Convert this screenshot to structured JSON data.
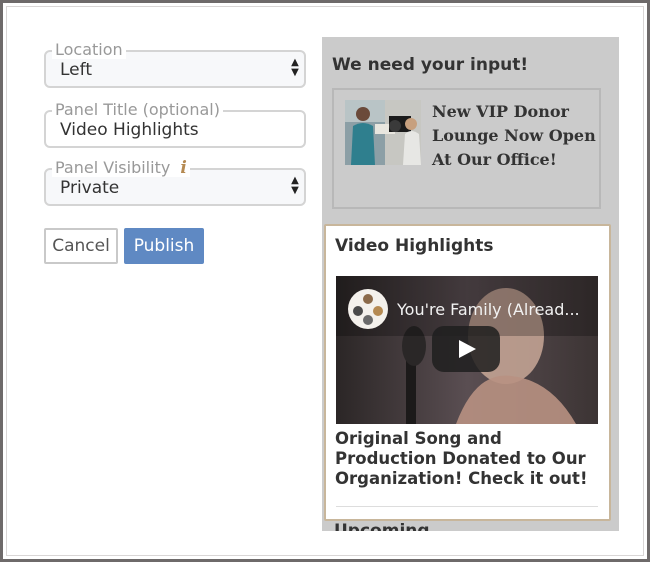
{
  "form": {
    "location": {
      "label": "Location",
      "value": "Left"
    },
    "panel_title": {
      "label": "Panel Title (optional)",
      "value": "Video Highlights"
    },
    "visibility": {
      "label": "Panel Visibility",
      "value": "Private",
      "info_icon": "i"
    },
    "cancel_label": "Cancel",
    "publish_label": "Publish"
  },
  "preview": {
    "heading": "We need your input!",
    "news": {
      "title": "New VIP Donor Lounge Now Open At Our Office!"
    },
    "video_panel": {
      "title": "Video Highlights",
      "video_title": "You're Family (Alread...",
      "caption": "Original Song and Production Donated to Our Organization! Check it out!"
    },
    "next_section": "Upcoming"
  },
  "colors": {
    "publish": "#5f89c3",
    "preview_bg": "#cbcbcb",
    "info_icon": "#b58a52",
    "card_border": "#c8b69b"
  },
  "icons": [
    "select-arrows-icon",
    "info-icon",
    "play-icon",
    "channel-logo-icon"
  ]
}
